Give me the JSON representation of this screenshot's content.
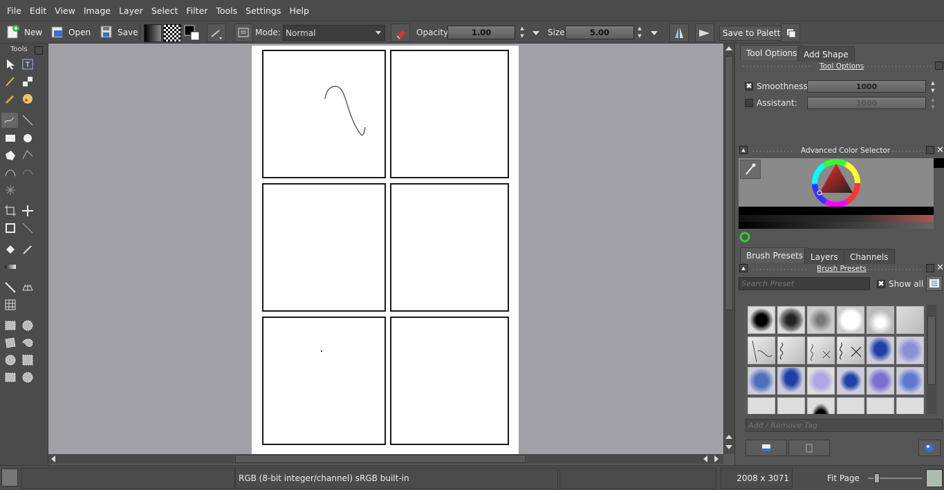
{
  "menu": [
    "File",
    "Edit",
    "View",
    "Image",
    "Layer",
    "Select",
    "Filter",
    "Tools",
    "Settings",
    "Help"
  ],
  "toolbar": {
    "new_label": "New",
    "open_label": "Open",
    "save_label": "Save",
    "mode_label": "Mode:",
    "mode_value": "Normal",
    "opacity_label": "Opacity:",
    "opacity_value": "1.00",
    "size_label": "Size:",
    "size_value": "5.00",
    "save_palette_label": "Save to Palette"
  },
  "toolbox": {
    "title": "Tools"
  },
  "dock": {
    "tabs_top": [
      "Tool Options",
      "Add Shape"
    ],
    "tool_options_title": "Tool Options",
    "smoothness_label": "Smoothness:",
    "smoothness_value": "1000",
    "assistant_label": "Assistant:",
    "assistant_value": "1000",
    "color_selector_title": "Advanced Color Selector",
    "tabs_bottom": [
      "Brush Presets",
      "Layers",
      "Channels"
    ],
    "brush_presets_title": "Brush Presets",
    "search_placeholder": "Search Preset",
    "show_all_label": "Show all",
    "tag_placeholder": "Add / Remove Tag"
  },
  "status": {
    "color_profile": "RGB (8-bit integer/channel)  sRGB built-in",
    "dimensions": "2008 x 3071",
    "zoom_mode": "Fit Page"
  },
  "colors": {
    "bg_dark": "#4b4b4b",
    "canvas_bg": "#a1a0a6",
    "accent": "#3b6fd0"
  }
}
